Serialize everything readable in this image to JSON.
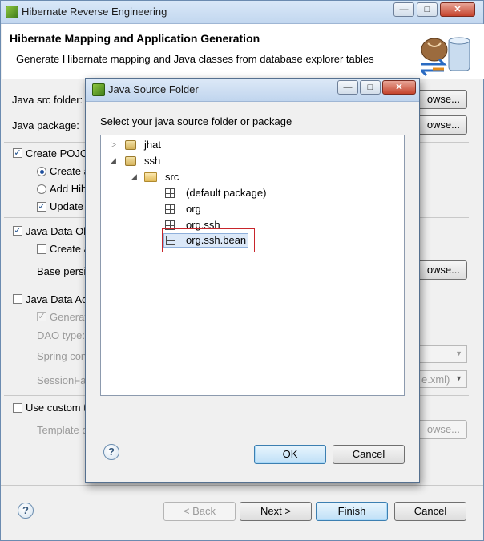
{
  "outer_window": {
    "title": "Hibernate Reverse Engineering",
    "banner": {
      "title": "Hibernate Mapping and Application Generation",
      "subtitle": "Generate Hibernate mapping and Java classes from database explorer tables"
    },
    "java_src_folder_label": "Java src folder:",
    "java_package_label": "Java package:",
    "browse_label": "owse...",
    "create_pojo_label": "Create POJO",
    "create_a_label": "Create a",
    "add_hib_label": "Add Hib",
    "update_label": "Update",
    "java_data_obj_label": "Java Data Ob",
    "create_a2_label": "Create a",
    "base_persi_label": "Base persi",
    "java_data_acc_label": "Java Data Ac",
    "generat_label": "Generat",
    "dao_type_label": "DAO type:",
    "spring_con_label": "Spring con",
    "session_fac_label": "SessionFac",
    "session_fac_value": "e.xml)",
    "use_custom_label": "Use custom t",
    "template_label": "Template d",
    "buttons": {
      "back": "< Back",
      "next": "Next >",
      "finish": "Finish",
      "cancel": "Cancel"
    }
  },
  "dialog": {
    "title": "Java Source Folder",
    "prompt": "Select your java source folder or package",
    "tree": {
      "items": [
        {
          "label": "jhat"
        },
        {
          "label": "ssh"
        },
        {
          "label": "src"
        },
        {
          "label": "(default package)"
        },
        {
          "label": "org"
        },
        {
          "label": "org.ssh"
        },
        {
          "label": "org.ssh.bean"
        }
      ]
    },
    "buttons": {
      "ok": "OK",
      "cancel": "Cancel"
    },
    "help_glyph": "?"
  },
  "colors": {
    "selection_border": "#c8252b",
    "accent": "#3c7fb1"
  }
}
